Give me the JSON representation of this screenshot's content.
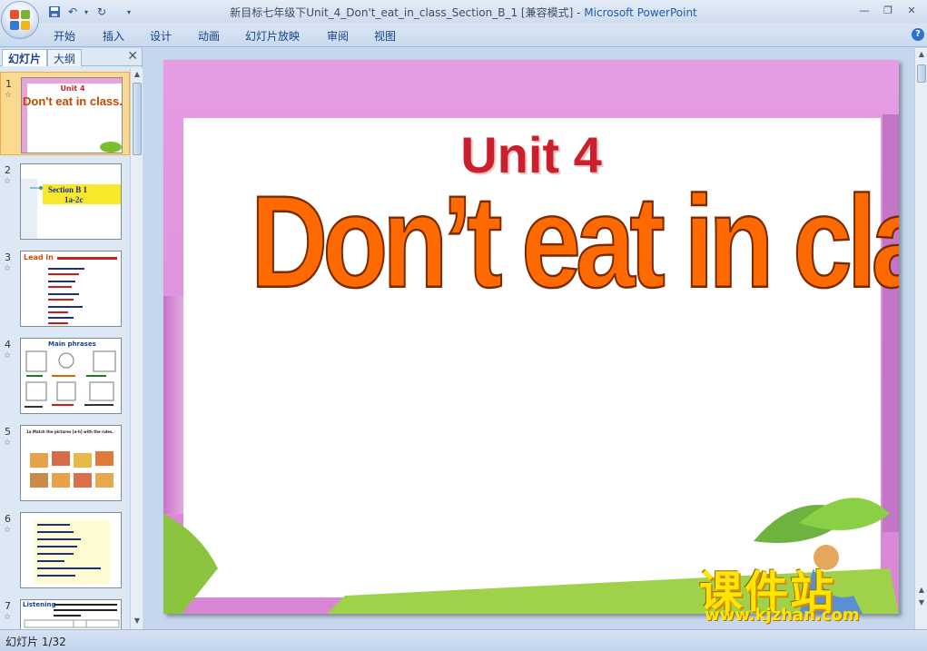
{
  "window": {
    "title": "新目标七年级下Unit_4_Don't_eat_in_class_Section_B_1 [兼容模式]",
    "app_name": "Microsoft PowerPoint"
  },
  "ribbon": {
    "tabs": [
      "开始",
      "插入",
      "设计",
      "动画",
      "幻灯片放映",
      "审阅",
      "视图"
    ]
  },
  "panel": {
    "tab_slides": "幻灯片",
    "tab_outline": "大纲",
    "close": "✕",
    "thumbs": [
      {
        "num": "1",
        "title": "Unit 4",
        "text": "Don't eat in class."
      },
      {
        "num": "2",
        "title": "Section B  1",
        "text": "1a-2c"
      },
      {
        "num": "3",
        "title": "Lead in",
        "text": ""
      },
      {
        "num": "4",
        "title": "Main phrases",
        "text": ""
      },
      {
        "num": "5",
        "title": "1a Match the pictures [a-h] with the rules.",
        "text": ""
      },
      {
        "num": "6",
        "title": "",
        "text": ""
      },
      {
        "num": "7",
        "title": "Listening",
        "text": ""
      }
    ]
  },
  "slide": {
    "unit": "Unit 4",
    "title": "Don’t  eat in class."
  },
  "watermark": {
    "line1": "课件站",
    "line2": "www.kjzhan.com"
  },
  "status": {
    "slide_counter": "幻灯片 1/32"
  },
  "colors": {
    "unit_red": "#cc1f2e",
    "title_orange": "#ff6a00",
    "selected_thumb": "#fbd98e"
  }
}
